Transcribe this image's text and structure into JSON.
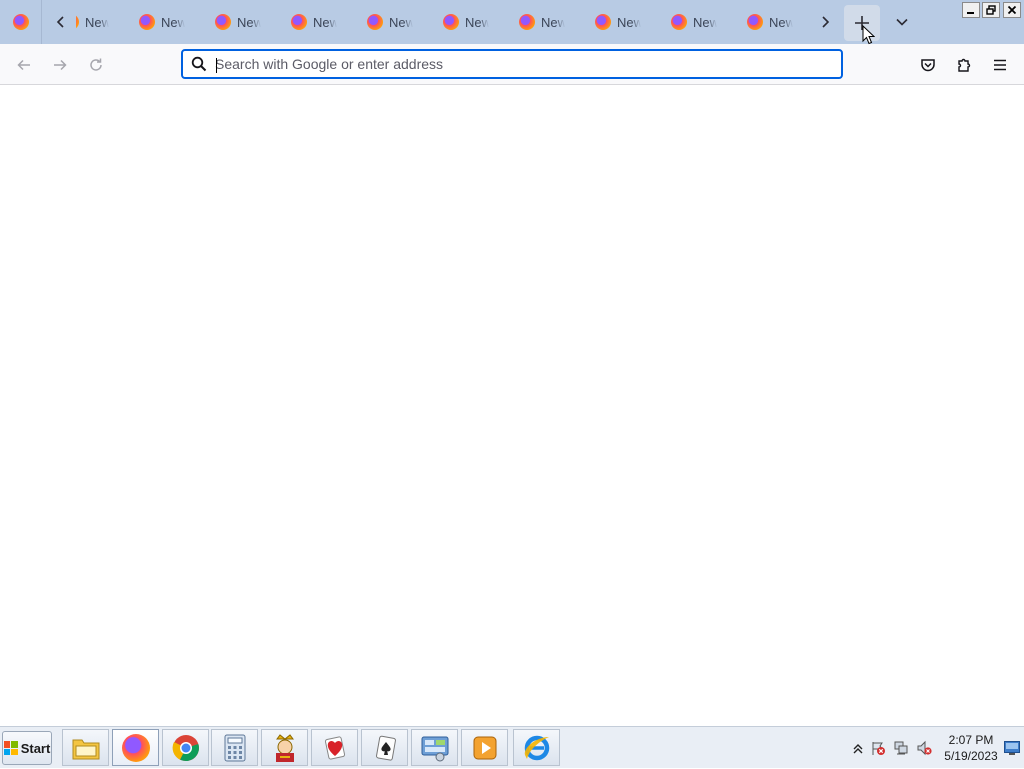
{
  "browser": {
    "tab_title": "New Tab",
    "tab_count_visible": 10,
    "urlbar_placeholder": "Search with Google or enter address"
  },
  "icons": {
    "pinned_tab": "firefox-icon",
    "scroll_left": "chevron-left-icon",
    "scroll_right": "chevron-right-icon",
    "new_tab": "plus-icon",
    "list_all_tabs": "chevron-down-icon",
    "back": "arrow-left-icon",
    "forward": "arrow-right-icon",
    "reload": "reload-icon",
    "search": "search-icon",
    "pocket": "pocket-icon",
    "extensions": "puzzle-icon",
    "menu": "hamburger-menu-icon"
  },
  "taskbar": {
    "start_label": "Start",
    "apps": [
      "file-explorer",
      "firefox",
      "chrome",
      "calculator",
      "solitaire-king",
      "hearts",
      "spider-solitaire",
      "control-panel",
      "media-player",
      "internet-explorer"
    ],
    "clock_time": "2:07 PM",
    "clock_date": "5/19/2023"
  },
  "colors": {
    "tabstrip": "#b8cbe4",
    "urlbar_focus": "#0061e0",
    "navbar": "#f9f9fb"
  }
}
